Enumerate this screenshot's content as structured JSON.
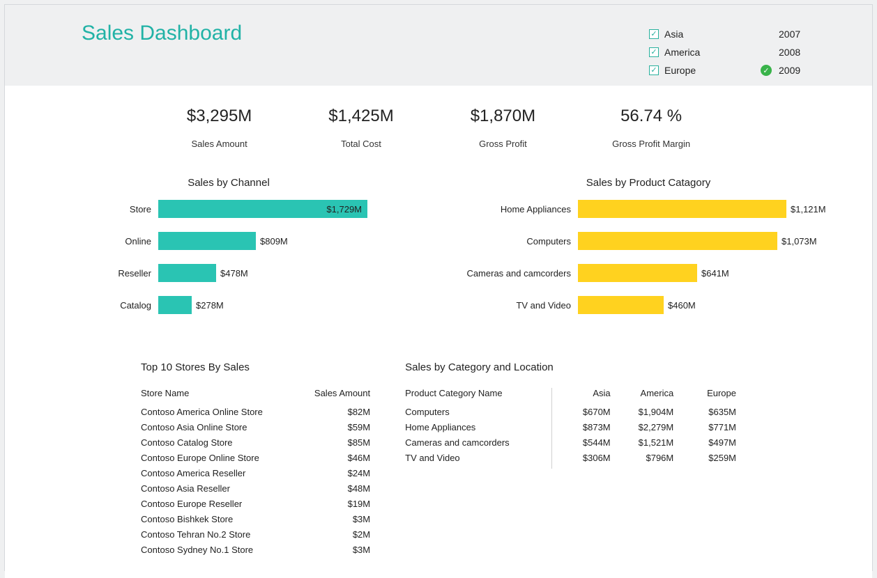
{
  "title": "Sales Dashboard",
  "filters": {
    "regions": [
      {
        "label": "Asia",
        "checked": true
      },
      {
        "label": "America",
        "checked": true
      },
      {
        "label": "Europe",
        "checked": true
      }
    ],
    "years": [
      {
        "label": "2007",
        "active": false
      },
      {
        "label": "2008",
        "active": false
      },
      {
        "label": "2009",
        "active": true
      }
    ]
  },
  "kpis": [
    {
      "value": "$3,295M",
      "label": "Sales Amount"
    },
    {
      "value": "$1,425M",
      "label": "Total Cost"
    },
    {
      "value": "$1,870M",
      "label": "Gross Profit"
    },
    {
      "value": "56.74 %",
      "label": "Gross Profit Margin"
    }
  ],
  "chart_data": [
    {
      "type": "bar",
      "title": "Sales by Channel",
      "color": "#2ac4b3",
      "categories": [
        "Store",
        "Online",
        "Reseller",
        "Catalog"
      ],
      "values": [
        1729,
        809,
        478,
        278
      ],
      "value_labels": [
        "$1,729M",
        "$809M",
        "$478M",
        "$278M"
      ],
      "max": 1729
    },
    {
      "type": "bar",
      "title": "Sales by Product Catagory",
      "color": "#ffd21f",
      "categories": [
        "Home Appliances",
        "Computers",
        "Cameras and camcorders",
        "TV and Video"
      ],
      "values": [
        1121,
        1073,
        641,
        460
      ],
      "value_labels": [
        "$1,121M",
        "$1,073M",
        "$641M",
        "$460M"
      ],
      "max": 1200
    }
  ],
  "stores_table": {
    "title": "Top 10 Stores By Sales",
    "headers": [
      "Store Name",
      "Sales Amount"
    ],
    "rows": [
      [
        "Contoso America Online Store",
        "$82M"
      ],
      [
        "Contoso Asia Online Store",
        "$59M"
      ],
      [
        "Contoso Catalog Store",
        "$85M"
      ],
      [
        "Contoso Europe Online Store",
        "$46M"
      ],
      [
        "Contoso America Reseller",
        "$24M"
      ],
      [
        "Contoso Asia Reseller",
        "$48M"
      ],
      [
        "Contoso Europe Reseller",
        "$19M"
      ],
      [
        "Contoso Bishkek Store",
        "$3M"
      ],
      [
        "Contoso Tehran No.2 Store",
        "$2M"
      ],
      [
        "Contoso Sydney No.1 Store",
        "$3M"
      ]
    ]
  },
  "cat_loc_table": {
    "title": "Sales by Category and Location",
    "headers": [
      "Product Category Name",
      "Asia",
      "America",
      "Europe"
    ],
    "rows": [
      [
        "Computers",
        "$670M",
        "$1,904M",
        "$635M"
      ],
      [
        "Home Appliances",
        "$873M",
        "$2,279M",
        "$771M"
      ],
      [
        "Cameras and camcorders",
        "$544M",
        "$1,521M",
        "$497M"
      ],
      [
        "TV and Video",
        "$306M",
        "$796M",
        "$259M"
      ]
    ]
  }
}
